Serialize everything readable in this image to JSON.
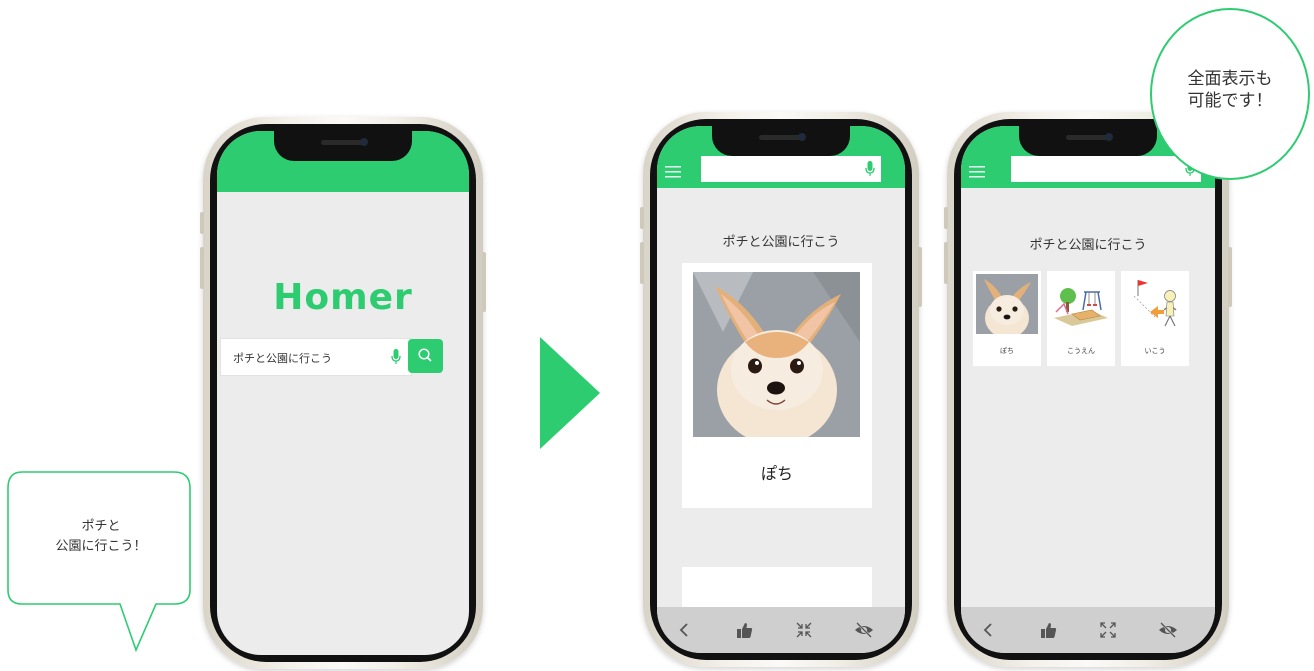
{
  "brand": {
    "name": "Homer",
    "color": "#2ecc71"
  },
  "search": {
    "query": "ポチと公園に行こう",
    "mic_icon": "microphone-icon",
    "search_icon": "search-icon"
  },
  "result_single": {
    "sentence": "ポチと公園に行こう",
    "card_label": "ぽち"
  },
  "result_full": {
    "sentence": "ポチと公園に行こう",
    "cards": [
      {
        "label": "ぽち",
        "icon": "dog-photo"
      },
      {
        "label": "こうえん",
        "icon": "park-illustration"
      },
      {
        "label": "いこう",
        "icon": "walking-person-illustration"
      }
    ]
  },
  "toolbar": {
    "icons": [
      "back-icon",
      "thumbs-up-icon",
      "collapse-icon",
      "hide-icon"
    ],
    "icons_full": [
      "back-icon",
      "thumbs-up-icon",
      "expand-icon",
      "hide-icon"
    ]
  },
  "speech_bubble_left": {
    "line1": "ポチと",
    "line2": "公園に行こう！"
  },
  "speech_bubble_right": {
    "line1": "全面表示も",
    "line2": "可能です！"
  }
}
